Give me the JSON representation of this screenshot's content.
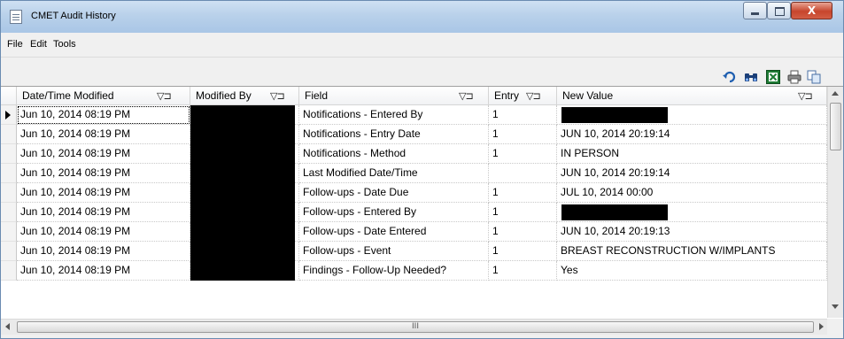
{
  "window": {
    "title": "CMET Audit History",
    "controls": {
      "close": "X"
    }
  },
  "menu": [
    "File",
    "Edit",
    "Tools"
  ],
  "toolbar": {
    "icons": [
      "undo-icon",
      "find-icon",
      "excel-icon",
      "print-icon",
      "copy-icon"
    ]
  },
  "grid": {
    "columns": [
      "Date/Time Modified",
      "Modified By",
      "Field",
      "Entry",
      "New Value"
    ],
    "filter_glyph": "▽⊐",
    "rows": [
      {
        "date": "Jun 10, 2014 08:19 PM",
        "modified_by": "",
        "field": "Notifications - Entered By",
        "entry": "1",
        "new_value": ""
      },
      {
        "date": "Jun 10, 2014 08:19 PM",
        "modified_by": "",
        "field": "Notifications - Entry Date",
        "entry": "1",
        "new_value": "JUN 10, 2014 20:19:14"
      },
      {
        "date": "Jun 10, 2014 08:19 PM",
        "modified_by": "",
        "field": "Notifications - Method",
        "entry": "1",
        "new_value": "IN PERSON"
      },
      {
        "date": "Jun 10, 2014 08:19 PM",
        "modified_by": "",
        "field": "Last Modified Date/Time",
        "entry": "",
        "new_value": "JUN 10, 2014 20:19:14"
      },
      {
        "date": "Jun 10, 2014 08:19 PM",
        "modified_by": "",
        "field": "Follow-ups - Date Due",
        "entry": "1",
        "new_value": "JUL 10, 2014 00:00"
      },
      {
        "date": "Jun 10, 2014 08:19 PM",
        "modified_by": "",
        "field": "Follow-ups - Entered By",
        "entry": "1",
        "new_value": ""
      },
      {
        "date": "Jun 10, 2014 08:19 PM",
        "modified_by": "",
        "field": "Follow-ups - Date Entered",
        "entry": "1",
        "new_value": "JUN 10, 2014 20:19:13"
      },
      {
        "date": "Jun 10, 2014 08:19 PM",
        "modified_by": "",
        "field": "Follow-ups - Event",
        "entry": "1",
        "new_value": "BREAST RECONSTRUCTION W/IMPLANTS"
      },
      {
        "date": "Jun 10, 2014 08:19 PM",
        "modified_by": "",
        "field": "Findings - Follow-Up Needed?",
        "entry": "1",
        "new_value": "Yes"
      }
    ]
  },
  "scrollbar": {
    "h_thumb_grip": "III"
  }
}
